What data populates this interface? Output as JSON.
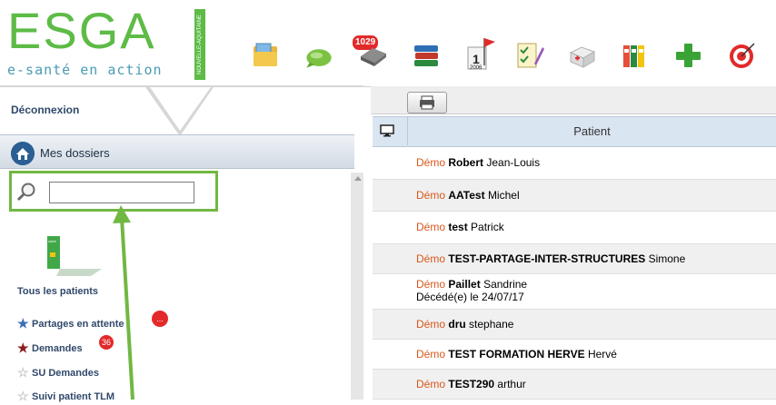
{
  "logo": {
    "brand": "ESGA",
    "tagline": "e-santé en action",
    "region": "NOUVELLE-AQUITAINE"
  },
  "toolbar": {
    "icons": [
      "folder-icon",
      "message-icon",
      "disk-icon",
      "books-icon",
      "calendar-icon",
      "checklist-icon",
      "medical-kit-icon",
      "binders-icon",
      "plus-icon",
      "target-icon"
    ],
    "message_badge": "1029",
    "calendar_day": "1",
    "calendar_year": "2006"
  },
  "sidebar": {
    "deconnexion": "Déconnexion",
    "mes_dossiers": "Mes dossiers",
    "search_value": "",
    "tous_patients": "Tous les patients",
    "links": [
      {
        "label": "Partages en attente",
        "badge": "...",
        "star_color": "#3b6fb5"
      },
      {
        "label": "Demandes",
        "badge": "36",
        "star_color": "#8b1e1e"
      },
      {
        "label": "SU Demandes",
        "badge": "",
        "star_color": "#cfcfcf"
      },
      {
        "label": "Suivi patient TLM",
        "badge": "",
        "star_color": "#cfcfcf"
      }
    ]
  },
  "table": {
    "column_patient": "Patient",
    "rows": [
      {
        "prefix": "Démo",
        "last": "Robert",
        "first": "Jean-Louis",
        "note": ""
      },
      {
        "prefix": "Démo",
        "last": "AATest",
        "first": "Michel",
        "note": ""
      },
      {
        "prefix": "Démo",
        "last": "test",
        "first": "Patrick",
        "note": ""
      },
      {
        "prefix": "Démo",
        "last": "TEST-PARTAGE-INTER-STRUCTURES",
        "first": "Simone",
        "note": ""
      },
      {
        "prefix": "Démo",
        "last": "Paillet",
        "first": "Sandrine",
        "note": "Décédé(e) le 24/07/17"
      },
      {
        "prefix": "Démo",
        "last": "dru",
        "first": "stephane",
        "note": ""
      },
      {
        "prefix": "Démo",
        "last": "TEST FORMATION HERVE",
        "first": "Hervé",
        "note": ""
      },
      {
        "prefix": "Démo",
        "last": "TEST290",
        "first": "arthur",
        "note": ""
      }
    ]
  },
  "colors": {
    "accent_green": "#71b843",
    "brand_green": "#5dbb46",
    "brand_blue": "#4a9bb3",
    "link_navy": "#30486b",
    "demo_orange": "#d9561a",
    "badge_red": "#e22a2a"
  }
}
